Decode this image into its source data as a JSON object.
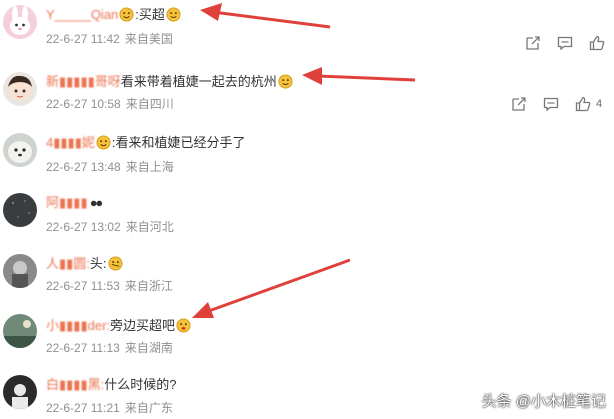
{
  "comments": [
    {
      "username": "Y_____Qian",
      "text": ":买超",
      "time": "22-6-27 11:42",
      "source": "来自美国",
      "likes": ""
    },
    {
      "username": "新▮▮▮▮▮哥呀",
      "text": "看来带着植婕一起去的杭州",
      "time": "22-6-27 10:58",
      "source": "来自四川",
      "likes": "4"
    },
    {
      "username": "4▮▮▮▮妮",
      "text": ":看来和植婕已经分手了",
      "time": "22-6-27 13:48",
      "source": "来自上海",
      "likes": ""
    },
    {
      "username": "阿▮▮▮▮",
      "text": "",
      "time": "22-6-27 13:02",
      "source": "来自河北",
      "likes": ""
    },
    {
      "username": "人▮▮圆:",
      "text": "头:",
      "time": "22-6-27 11:53",
      "source": "来自浙江",
      "likes": ""
    },
    {
      "username": "小▮▮▮▮der:",
      "text": "旁边买超吧",
      "time": "22-6-27 11:13",
      "source": "来自湖南",
      "likes": ""
    },
    {
      "username": "白▮▮▮▮黑:",
      "text": "什么时候的?",
      "time": "22-6-27 11:21",
      "source": "来自广东",
      "likes": ""
    }
  ],
  "icons": {
    "share": "share-icon",
    "comment": "comment-icon",
    "like": "like-icon"
  },
  "colors": {
    "username": "#eb7350",
    "meta": "#909090",
    "arrow": "#e0403a"
  },
  "watermark": "头条 @小木桩笔记"
}
